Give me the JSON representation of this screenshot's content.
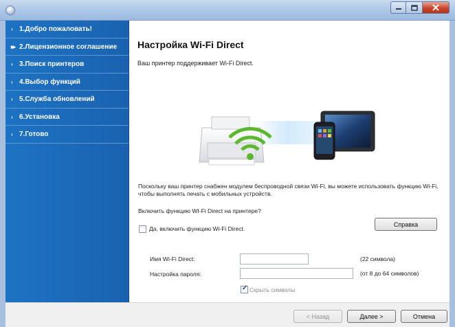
{
  "sidebar": {
    "items": [
      {
        "label": "1.Добро пожаловать!",
        "active": false
      },
      {
        "label": "2.Лицензионное соглашение",
        "active": true
      },
      {
        "label": "3.Поиск принтеров",
        "active": false
      },
      {
        "label": "4.Выбор функций",
        "active": false
      },
      {
        "label": "5.Служба обновлений",
        "active": false
      },
      {
        "label": "6.Установка",
        "active": false
      },
      {
        "label": "7.Готово",
        "active": false
      }
    ],
    "colors": {
      "background": "#1e73c4",
      "separator": "#5d98d2"
    }
  },
  "main": {
    "title": "Настройка Wi-Fi Direct",
    "subtitle": "Ваш принтер поддерживает Wi-Fi Direct.",
    "description": "Поскольку ваш принтер снабжен модулем беспроводной связи Wi-Fi, вы можете использовать функцию Wi-Fi, чтобы выполнять печать с мобильных устройств.",
    "question": "Включить функцию WI-Fi Direct на принтере?",
    "enable_checkbox_label": "Да, включить функцию Wi-Fi Direct.",
    "enable_checked": false,
    "help_button": "Справка",
    "name_label": "Имя Wi-Fi Direct:",
    "name_value": "",
    "name_hint": "(22 символа)",
    "password_label": "Настройка пароля:",
    "password_value": "",
    "password_hint": "(от 8 до 64 символов)",
    "hide_checkbox_label": "Скрыть символы",
    "hide_checked": true
  },
  "footer": {
    "back": "< Назад",
    "next": "Далее >",
    "cancel": "Отмена"
  },
  "icons": {
    "app": "app-icon",
    "minimize": "minimize-icon",
    "maximize": "maximize-icon",
    "close": "close-icon",
    "printer": "printer-icon",
    "wifi": "wifi-icon",
    "phone": "smartphone-icon",
    "tablet": "tablet-icon"
  },
  "colors": {
    "wifi_green": "#5cb82e",
    "title_bar": "#aac5e6",
    "close_button": "#c9472d"
  }
}
